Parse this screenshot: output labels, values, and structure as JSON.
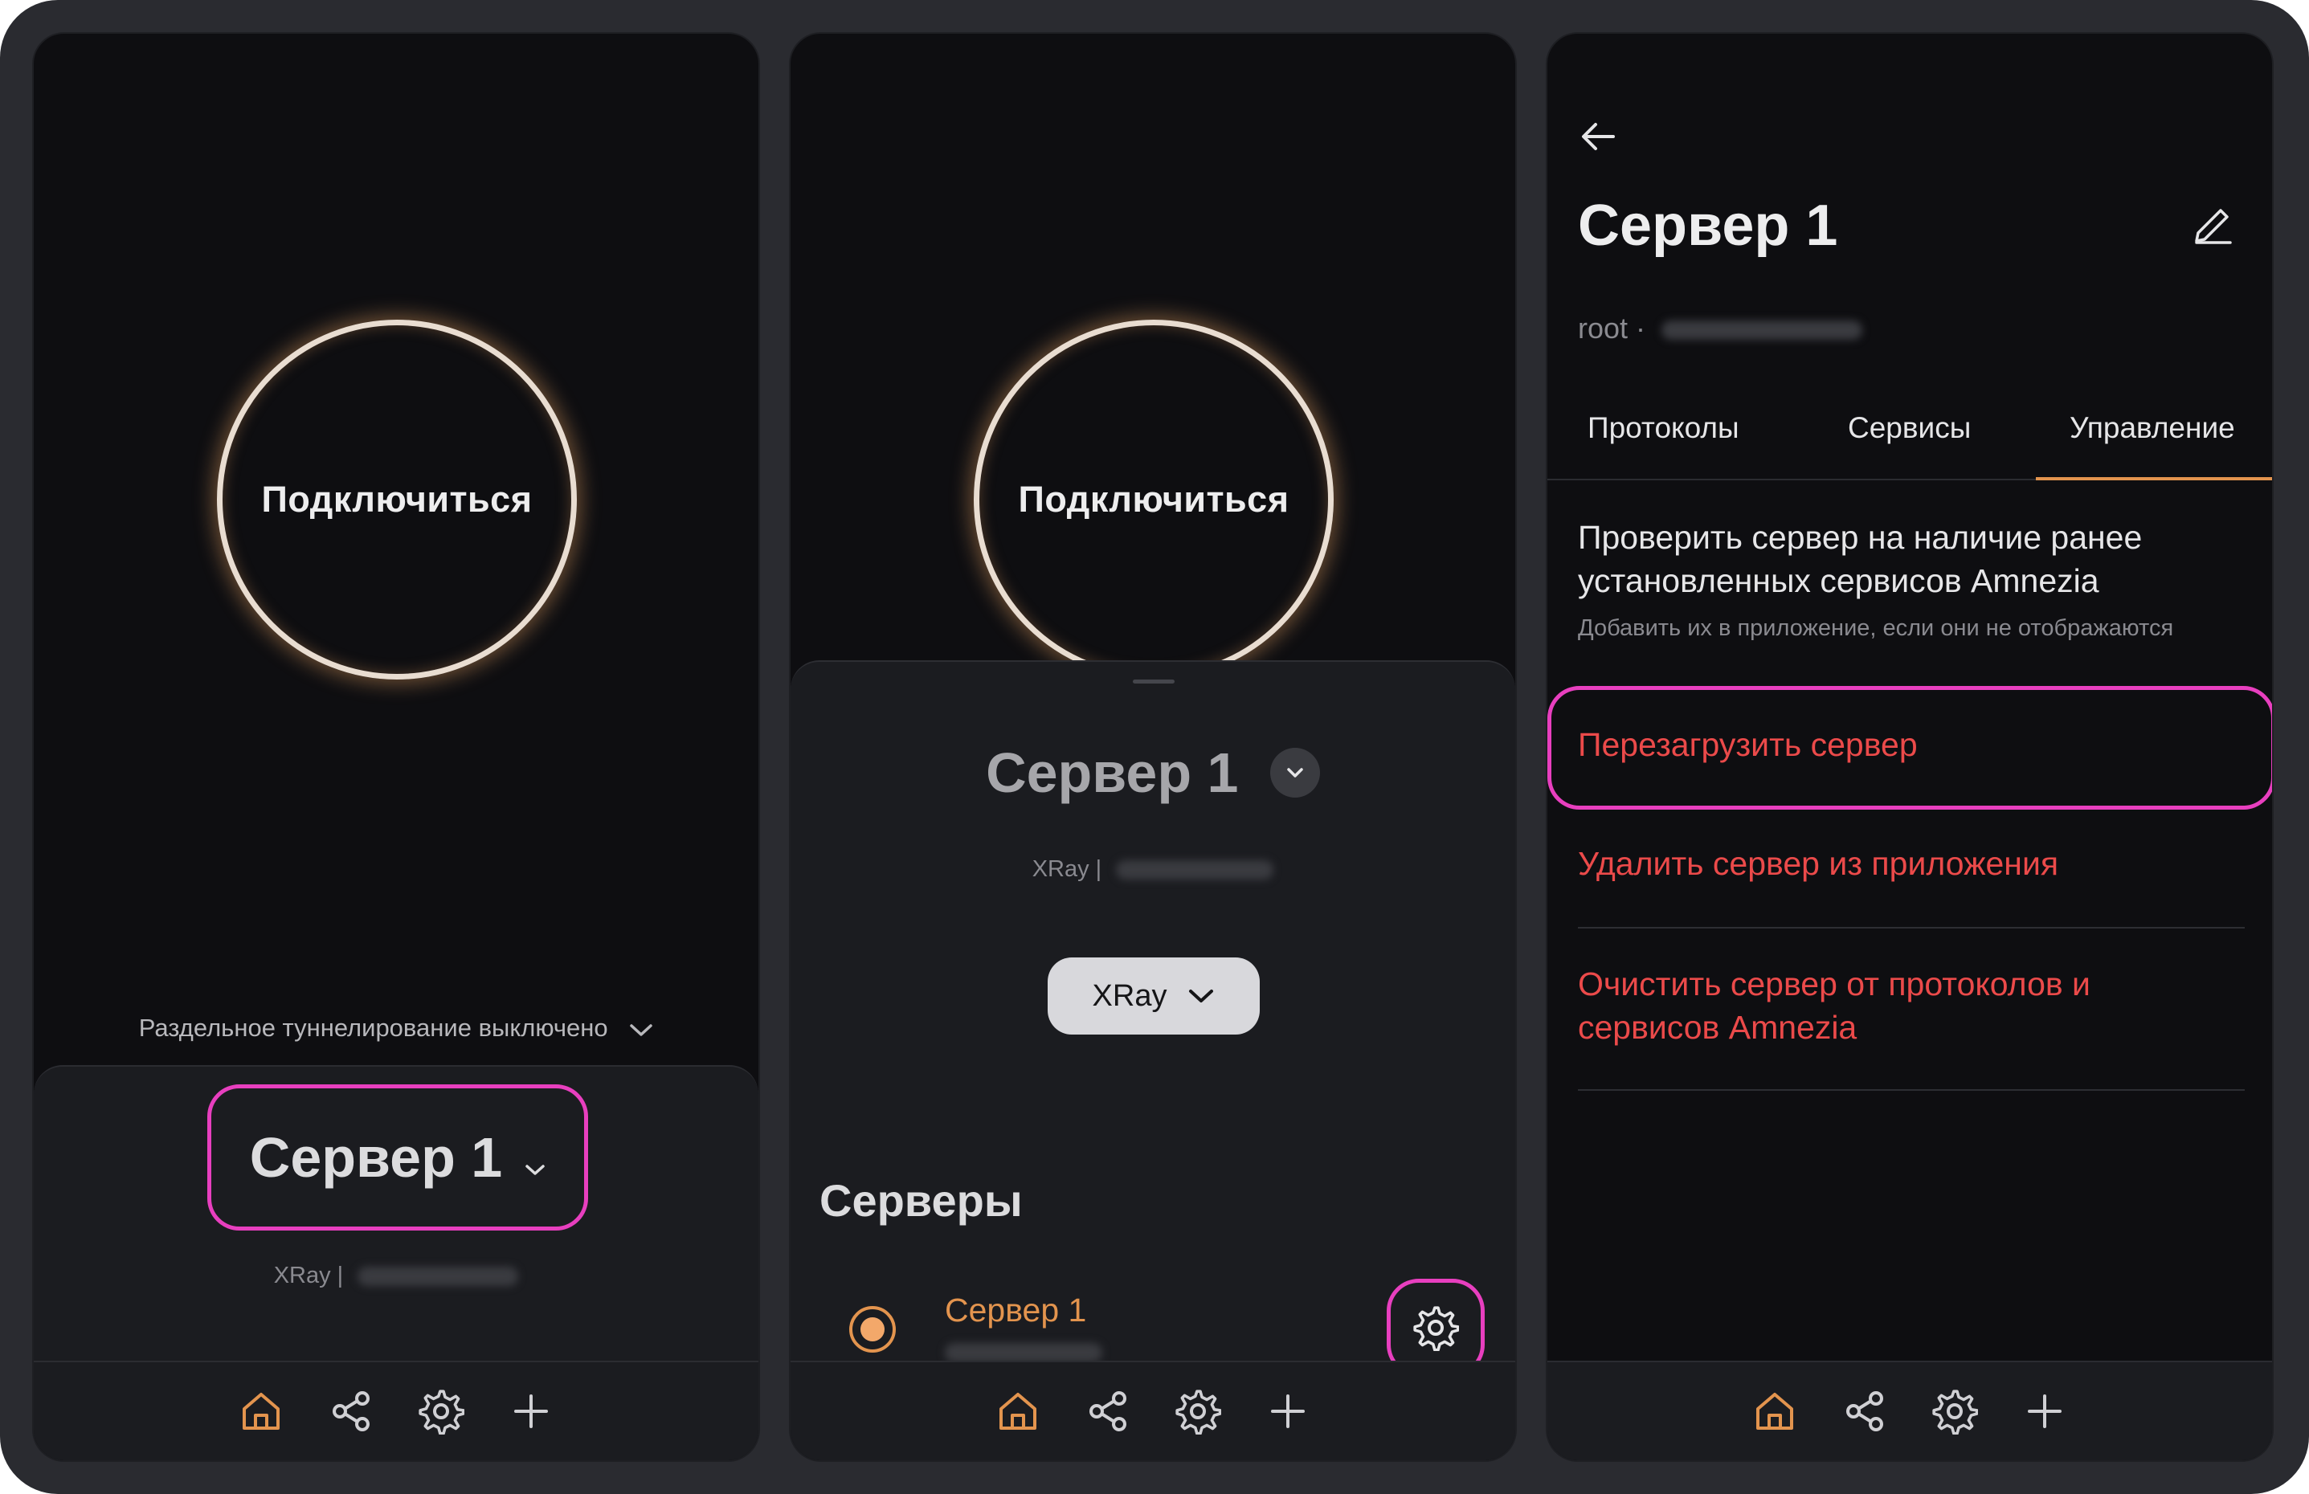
{
  "connect_label": "Подключиться",
  "server_name": "Сервер 1",
  "nav": [
    "home-icon",
    "share-icon",
    "gear-icon",
    "plus-icon"
  ],
  "colors": {
    "accent": "#e3944e",
    "highlight": "#e83fbf",
    "danger": "#eb4a4a"
  },
  "panel1": {
    "split_tunnel_text": "Раздельное туннелирование выключено",
    "protocol_prefix": "XRay |"
  },
  "panel2": {
    "protocol_prefix": "XRay |",
    "protocol_select": "XRay",
    "servers_heading": "Серверы",
    "server_item_name": "Сервер 1"
  },
  "panel3": {
    "title": "Сервер 1",
    "subtitle_prefix": "root ·",
    "tabs": [
      "Протоколы",
      "Сервисы",
      "Управление"
    ],
    "check_title": "Проверить сервер на наличие ранее установленных сервисов Amnezia",
    "check_subtitle": "Добавить их в приложение, если они не отображаются",
    "reboot": "Перезагрузить сервер",
    "remove": "Удалить сервер из приложения",
    "clear": "Очистить сервер от протоколов и сервисов Amnezia"
  }
}
